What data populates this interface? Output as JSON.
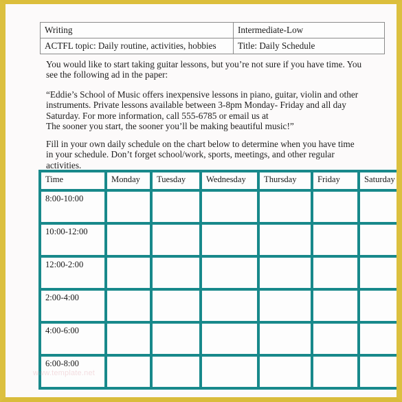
{
  "frame": {
    "border_color": "#dcc03f",
    "page_background": "#fcfafa"
  },
  "meta_table": {
    "rows": [
      {
        "left": "Writing",
        "right": "Intermediate-Low"
      },
      {
        "left": "ACTFL topic: Daily routine, activities, hobbies",
        "right": "Title: Daily Schedule"
      }
    ]
  },
  "body": {
    "intro": "You would like to start taking guitar lessons, but you’re not sure if you have time.  You see the following ad in the paper:",
    "ad": "“Eddie’s School of Music offers inexpensive lessons in piano, guitar, violin and other instruments.  Private lessons available between 3-8pm Monday- Friday and all day Saturday.  For more information, call 555-6785 or email us at\nThe sooner you start, the sooner you’ll be making beautiful music!”",
    "fill_instruction": "Fill in your own daily schedule on the chart below to determine when you have time in your schedule.  Don’t forget school/work, sports, meetings, and other regular activities."
  },
  "schedule": {
    "border_color": "#18898b",
    "headers": [
      "Time",
      "Monday",
      "Tuesday",
      "Wednesday",
      "Thursday",
      "Friday",
      "Saturday"
    ],
    "time_slots": [
      "8:00-10:00",
      "10:00-12:00",
      "12:00-2:00",
      "2:00-4:00",
      "4:00-6:00",
      "6:00-8:00"
    ],
    "cells": [
      [
        "",
        "",
        "",
        "",
        "",
        ""
      ],
      [
        "",
        "",
        "",
        "",
        "",
        ""
      ],
      [
        "",
        "",
        "",
        "",
        "",
        ""
      ],
      [
        "",
        "",
        "",
        "",
        "",
        ""
      ],
      [
        "",
        "",
        "",
        "",
        "",
        ""
      ],
      [
        "",
        "",
        "",
        "",
        "",
        ""
      ]
    ]
  },
  "watermark": {
    "text": "www.template.net"
  }
}
